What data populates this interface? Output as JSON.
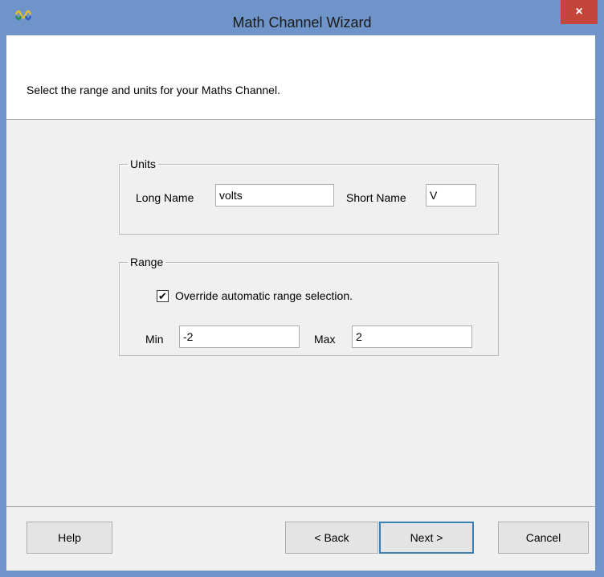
{
  "window": {
    "title": "Math Channel Wizard",
    "close_glyph": "×"
  },
  "header": {
    "instruction": "Select the range and units for your Maths Channel."
  },
  "units": {
    "legend": "Units",
    "long_name_label": "Long Name",
    "long_name_value": "volts",
    "short_name_label": "Short Name",
    "short_name_value": "V"
  },
  "range": {
    "legend": "Range",
    "override_label": "Override automatic range selection.",
    "override_checked": true,
    "check_glyph": "✔",
    "min_label": "Min",
    "min_value": "-2",
    "max_label": "Max",
    "max_value": "2"
  },
  "buttons": {
    "help": "Help",
    "back": "< Back",
    "next": "Next >",
    "cancel": "Cancel"
  },
  "colors": {
    "titlebar": "#6f94c9",
    "close": "#c4463b",
    "default_button_border": "#3c7fb1"
  },
  "icons": {
    "app": "waveform-icon"
  }
}
